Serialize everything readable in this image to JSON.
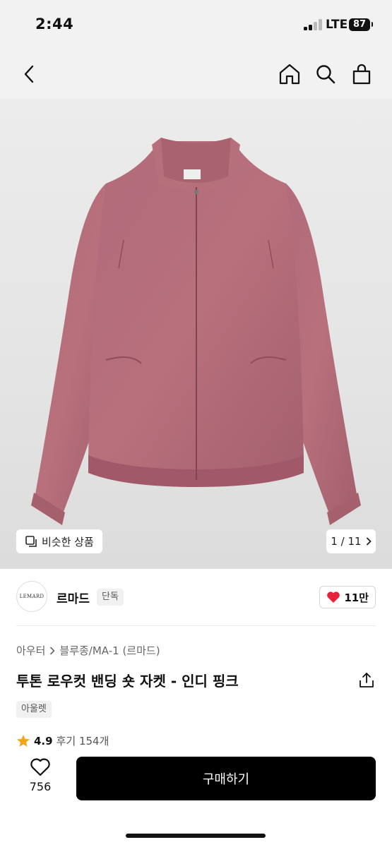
{
  "status_bar": {
    "time": "2:44",
    "network": "LTE",
    "battery": "87"
  },
  "nav": {
    "icons": [
      "back-arrow-icon",
      "home-icon",
      "search-icon",
      "shopping-bag-icon"
    ]
  },
  "hero": {
    "similar_products_label": "비슷한 상품",
    "image_counter": "1 / 11"
  },
  "brand": {
    "logo_text": "LEMARD",
    "name": "르마드",
    "badge": "단독",
    "likes": "11만",
    "like_color": "#e8223a"
  },
  "product": {
    "breadcrumb": [
      "아우터",
      "블루종/MA-1 (르마드)"
    ],
    "title": "투톤 로우컷 밴딩 숏 자켓 - 인디 핑크",
    "tag": "아울렛",
    "rating": "4.9",
    "reviews": "후기 154개",
    "rating_color": "#f2a516"
  },
  "bottom_bar": {
    "wish_count": "756",
    "buy_label": "구매하기"
  }
}
